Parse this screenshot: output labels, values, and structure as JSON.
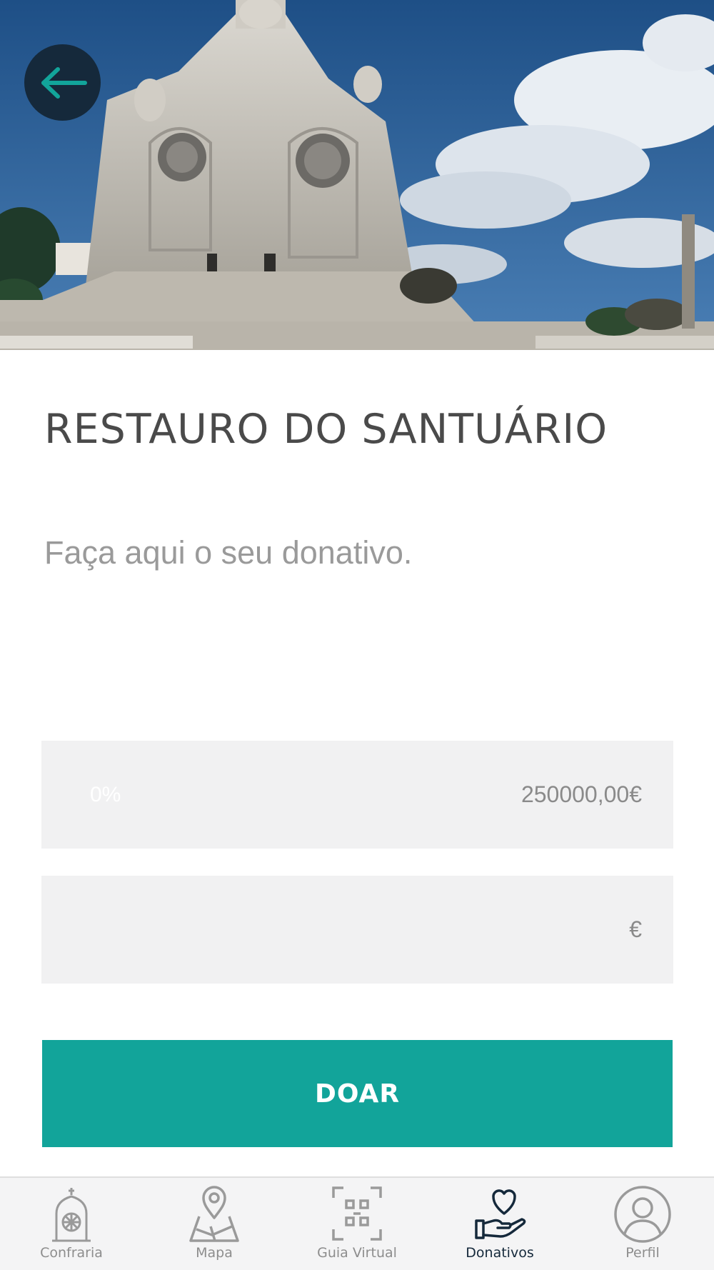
{
  "header": {
    "back_icon": "arrow-left-icon"
  },
  "project": {
    "title": "RESTAURO DO SANTUÁRIO",
    "subtitle": "Faça aqui o seu donativo."
  },
  "progress": {
    "percent_label": "0%",
    "fraction": 0,
    "goal_label": "250000,00€"
  },
  "donation_input": {
    "value": "",
    "currency": "€"
  },
  "donate_button": {
    "label": "DOAR"
  },
  "bottom_nav": {
    "items": [
      {
        "label": "Confraria",
        "icon": "church-icon",
        "active": false
      },
      {
        "label": "Mapa",
        "icon": "map-icon",
        "active": false
      },
      {
        "label": "Guia Virtual",
        "icon": "qr-code-icon",
        "active": false
      },
      {
        "label": "Donativos",
        "icon": "donation-hand-heart-icon",
        "active": true
      },
      {
        "label": "Perfil",
        "icon": "profile-icon",
        "active": false
      }
    ]
  },
  "colors": {
    "accent": "#12a49a",
    "dark": "#15293b",
    "field_bg": "#f1f1f2"
  }
}
